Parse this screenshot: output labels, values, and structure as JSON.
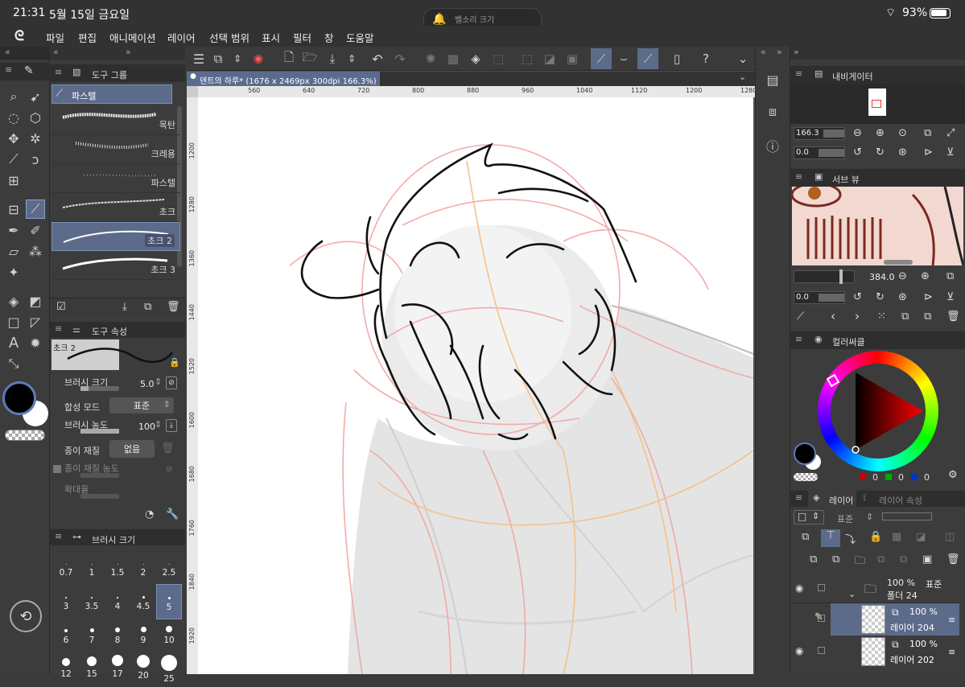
{
  "status": {
    "time": "21:31",
    "date": "5월 15일 금요일",
    "battery": "93%",
    "volume_label": "벨소리 크기"
  },
  "menu": [
    "파일",
    "편집",
    "애니메이션",
    "레이어",
    "선택 범위",
    "표시",
    "필터",
    "창",
    "도움말"
  ],
  "doc_tab": "덴트의 하루* (1676 x 2469px 300dpi 166.3%)",
  "ruler_top": [
    "560",
    "640",
    "720",
    "800",
    "880",
    "960",
    "1040",
    "1120",
    "1200",
    "1280"
  ],
  "ruler_left": [
    "1200",
    "1280",
    "1360",
    "1440",
    "1520",
    "1600",
    "1680",
    "1760",
    "1840",
    "1920"
  ],
  "tool_group": {
    "title": "도구 그룹",
    "header": "파스텔",
    "brushes": [
      "목탄",
      "크레용",
      "파스텔",
      "초크",
      "초크 2",
      "초크 3"
    ]
  },
  "tool_props": {
    "title": "도구 속성",
    "preview_name": "초크 2",
    "brush_size_label": "브러시 크기",
    "brush_size": "5.0",
    "blend_label": "합성 모드",
    "blend_value": "표준",
    "density_label": "브러시 농도",
    "density": "100",
    "paper_label": "종이 재질",
    "paper_value": "없음",
    "paper_density_label": "종이 재질 농도",
    "scale_label": "확대율"
  },
  "brush_size": {
    "title": "브러시 크기",
    "sizes": [
      "0.7",
      "1",
      "1.5",
      "2",
      "2.5",
      "3",
      "3.5",
      "4",
      "4.5",
      "5",
      "6",
      "7",
      "8",
      "9",
      "10",
      "12",
      "15",
      "17",
      "20",
      "25"
    ]
  },
  "navigator": {
    "title": "내비게이터",
    "zoom": "166.3",
    "angle": "0.0"
  },
  "subview": {
    "title": "서브 뷰",
    "zoom": "384.0",
    "angle": "0.0"
  },
  "color": {
    "title": "컬러써클",
    "r": "0",
    "g": "0",
    "b": "0",
    "main_color": "#000000",
    "sub_color": "#ffffff"
  },
  "layers": {
    "tab1": "레이어",
    "tab2": "레이어 속성",
    "blend": "표준",
    "items": [
      {
        "opacity": "100 %",
        "mode": "표준",
        "name": "폴더 24"
      },
      {
        "opacity": "100 %",
        "name": "레이어 204"
      },
      {
        "opacity": "100 %",
        "name": "레이어 202"
      }
    ]
  }
}
